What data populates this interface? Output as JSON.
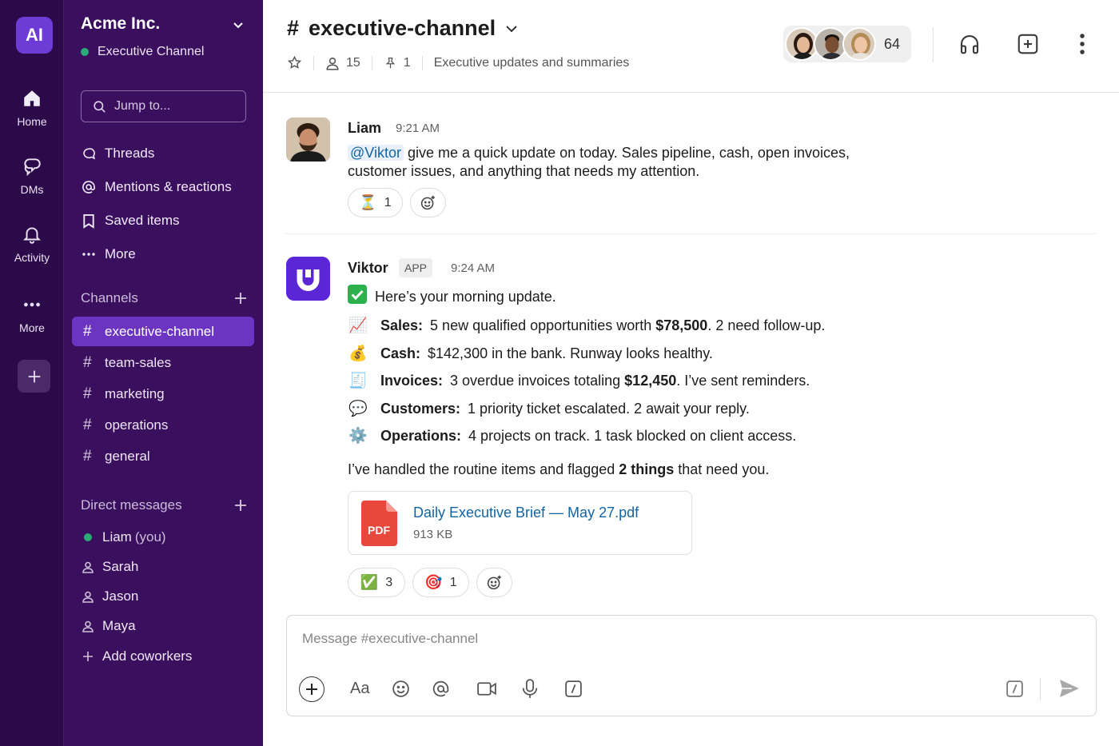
{
  "workspace": {
    "logo_text": "AI",
    "name": "Acme Inc.",
    "subtitle": "Executive Channel"
  },
  "rail": {
    "home": "Home",
    "dms": "DMs",
    "activity": "Activity",
    "more": "More"
  },
  "sidebar": {
    "search_placeholder": "Jump to...",
    "nav": [
      "Threads",
      "Mentions & reactions",
      "Saved items",
      "More"
    ],
    "channels_header": "Channels",
    "channels": [
      "executive-channel",
      "team-sales",
      "marketing",
      "operations",
      "general"
    ],
    "dms_header": "Direct messages",
    "dms": [
      {
        "name": "Liam",
        "suffix": "(you)"
      },
      {
        "name": "Sarah"
      },
      {
        "name": "Jason"
      },
      {
        "name": "Maya"
      }
    ],
    "add_coworkers": "Add coworkers"
  },
  "header": {
    "hash": "#",
    "channel": "executive-channel",
    "member_count": "15",
    "pin_count": "1",
    "topic": "Executive updates and summaries",
    "members_total": "64"
  },
  "messages": [
    {
      "author": "Liam",
      "time": "9:21 AM",
      "mention": "@Viktor",
      "text_line1": " give me a quick update on today. Sales pipeline, cash, open invoices,",
      "text_line2": "customer issues, and anything that needs my attention.",
      "reactions": [
        {
          "emoji": "⏳",
          "count": "1"
        }
      ]
    },
    {
      "author": "Viktor",
      "badge": "APP",
      "time": "9:24 AM",
      "intro": "Here’s your morning update.",
      "items": [
        {
          "emoji": "📈",
          "label": "Sales:",
          "text": "5 new qualified opportunities worth ",
          "bold": "$78,500",
          "after": ". 2 need follow-up."
        },
        {
          "emoji": "💰",
          "label": "Cash:",
          "text": "$142,300 in the bank. Runway looks healthy.",
          "bold": "",
          "after": ""
        },
        {
          "emoji": "🧾",
          "label": "Invoices:",
          "text": "3 overdue invoices totaling ",
          "bold": "$12,450",
          "after": ". I’ve sent reminders."
        },
        {
          "emoji": "💬",
          "label": "Customers:",
          "text": "1 priority ticket escalated. 2 await your reply.",
          "bold": "",
          "after": ""
        },
        {
          "emoji": "⚙️",
          "label": "Operations:",
          "text": "4 projects on track. 1 task blocked on client access.",
          "bold": "",
          "after": ""
        }
      ],
      "closing_pre": "I’ve handled the routine items and flagged ",
      "closing_bold": "2 things",
      "closing_post": " that need you.",
      "attachment": {
        "type_label": "PDF",
        "name": "Daily Executive Brief — May 27.pdf",
        "size": "913 KB"
      },
      "reactions": [
        {
          "emoji": "✅",
          "count": "3"
        },
        {
          "emoji": "🎯",
          "count": "1"
        }
      ]
    }
  ],
  "composer": {
    "placeholder": "Message #executive-channel",
    "format_label": "Aa"
  },
  "colors": {
    "rail_bg": "#2c0a4a",
    "sidebar_bg": "#3a0f5e",
    "active_channel": "#6b35c2",
    "link": "#1264a3",
    "online": "#2bac76"
  }
}
